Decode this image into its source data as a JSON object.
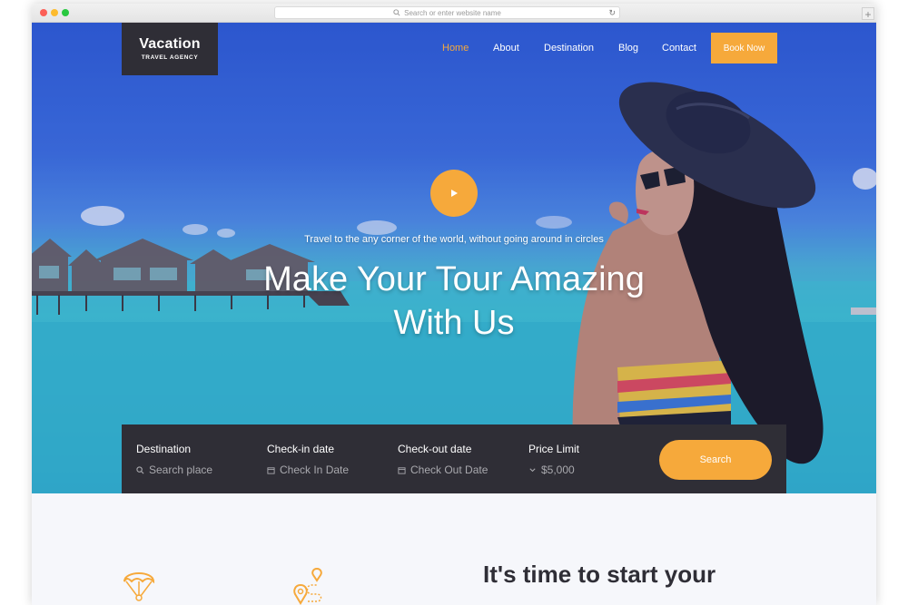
{
  "browser": {
    "url_placeholder": "Search or enter website name",
    "new_tab": "+"
  },
  "brand": {
    "name": "Vacation",
    "sub": "TRAVEL AGENCY"
  },
  "nav": {
    "items": [
      {
        "label": "Home",
        "active": true
      },
      {
        "label": "About",
        "active": false
      },
      {
        "label": "Destination",
        "active": false
      },
      {
        "label": "Blog",
        "active": false
      },
      {
        "label": "Contact",
        "active": false
      }
    ],
    "cta": "Book Now"
  },
  "hero": {
    "tagline": "Travel to the any corner of the world, without going around in circles",
    "headline_line1": "Make Your Tour Amazing",
    "headline_line2": "With Us",
    "play_icon": "play-icon"
  },
  "search": {
    "fields": [
      {
        "label": "Destination",
        "placeholder": "Search place",
        "icon": "search-icon"
      },
      {
        "label": "Check-in date",
        "placeholder": "Check In Date",
        "icon": "calendar-icon"
      },
      {
        "label": "Check-out date",
        "placeholder": "Check Out Date",
        "icon": "calendar-icon"
      },
      {
        "label": "Price Limit",
        "value": "$5,000",
        "icon": "chevron-down-icon"
      }
    ],
    "button": "Search"
  },
  "section": {
    "title": "It's time to start your",
    "icons": [
      "parachute-icon",
      "route-pin-icon"
    ]
  },
  "colors": {
    "accent": "#f6a93b",
    "dark": "#2f2e36",
    "section_bg": "#f6f7fb"
  }
}
